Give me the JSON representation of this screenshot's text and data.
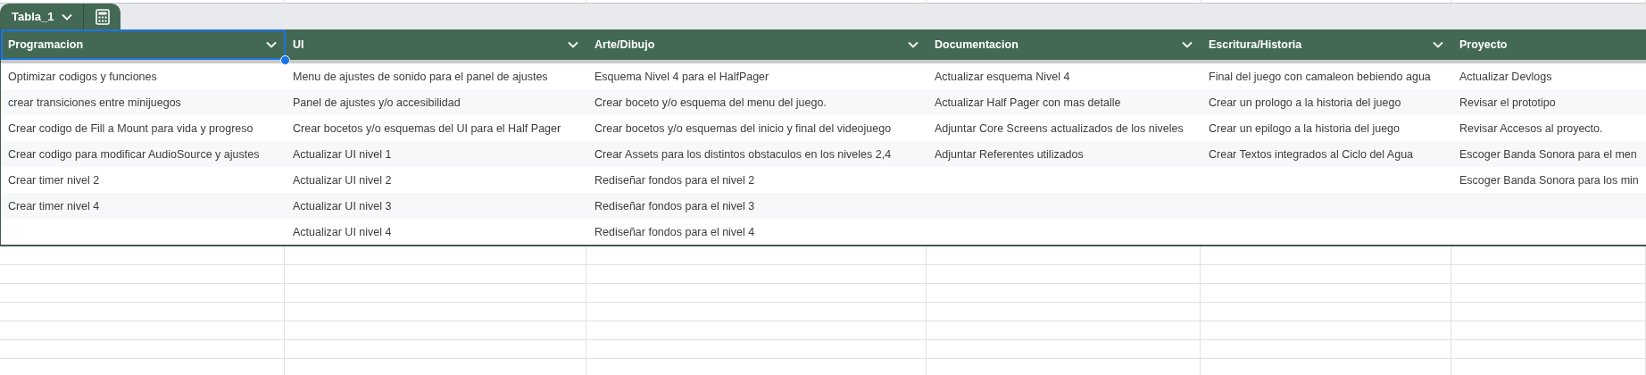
{
  "sheet_tab": {
    "label": "Tabla_1",
    "selected": true
  },
  "table": {
    "columns": [
      {
        "label": "Programacion",
        "selected": true,
        "filter_button": true,
        "items": [
          "Optimizar codigos y funciones",
          "crear transiciones entre minijuegos",
          "Crear codigo de Fill a Mount para vida y progreso",
          "Crear codigo para modificar AudioSource y ajustes",
          "Crear timer nivel 2",
          "Crear timer nivel 4"
        ]
      },
      {
        "label": "UI",
        "selected": false,
        "filter_button": true,
        "items": [
          "Menu de ajustes de sonido para el panel de ajustes",
          "Panel de ajustes y/o accesibilidad",
          "Crear bocetos y/o esquemas del UI para el Half Pager",
          "Actualizar UI nivel 1",
          "Actualizar UI nivel 2",
          "Actualizar UI nivel 3",
          "Actualizar UI nivel 4"
        ]
      },
      {
        "label": "Arte/Dibujo",
        "selected": false,
        "filter_button": true,
        "items": [
          "Esquema Nivel 4 para el HalfPager",
          "Crear boceto y/o esquema del menu del juego.",
          "Crear bocetos y/o esquemas del inicio y final del videojuego",
          "Crear Assets para los distintos obstaculos en los niveles 2,4",
          "Rediseñar fondos para el nivel 2",
          "Rediseñar fondos para el nivel 3",
          "Rediseñar fondos para el nivel 4"
        ]
      },
      {
        "label": "Documentacion",
        "selected": false,
        "filter_button": true,
        "items": [
          "Actualizar esquema Nivel 4",
          "Actualizar Half Pager con mas detalle",
          "Adjuntar Core Screens actualizados de los niveles",
          "Adjuntar Referentes utilizados"
        ]
      },
      {
        "label": "Escritura/Historia",
        "selected": false,
        "filter_button": true,
        "items": [
          "Final del juego con camaleon bebiendo agua",
          "Crear un prologo a la historia del juego",
          "Crear un epilogo a la historia del juego",
          "Crear Textos integrados al Ciclo del Agua"
        ]
      },
      {
        "label": "Proyecto",
        "selected": false,
        "filter_button": false,
        "items": [
          "Actualizar Devlogs",
          "Revisar el prototipo",
          "Revisar Accesos al proyecto.",
          "Escoger Banda Sonora para el men",
          "Escoger Banda Sonora para los min"
        ]
      }
    ]
  }
}
